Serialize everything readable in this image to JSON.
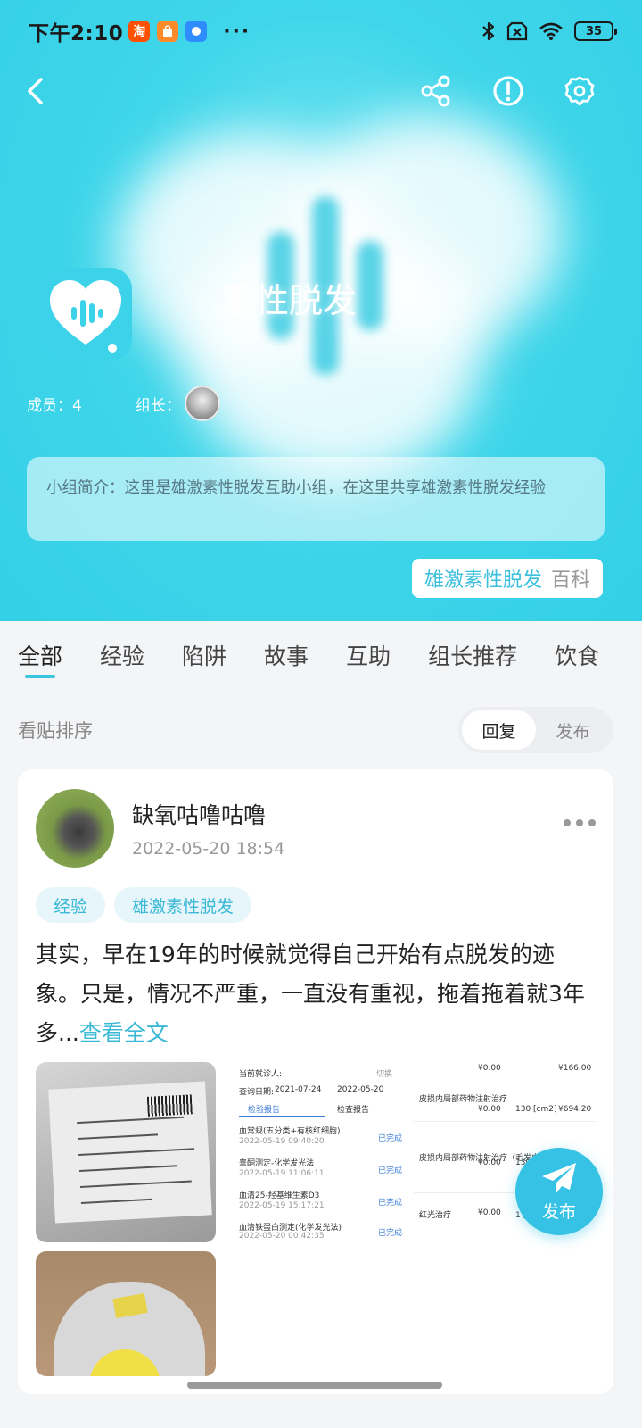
{
  "status_bar": {
    "time": "下午2:10",
    "app_icons": [
      "taobao-icon",
      "shopping-bag-icon",
      "message-bubble-icon"
    ],
    "taobao_text": "淘",
    "dots": "···",
    "battery": "35"
  },
  "header": {
    "group_name": "素性脱发",
    "members": "成员：4",
    "leader_label": "组长：",
    "intro": "小组简介：这里是雄激素性脱发互助小组，在这里共享雄激素性脱发经验",
    "wiki_keyword": "雄激素性脱发",
    "wiki_suffix": "百科",
    "accent_color": "#3cd3ea"
  },
  "tabs": [
    "全部",
    "经验",
    "陷阱",
    "故事",
    "互助",
    "组长推荐",
    "饮食"
  ],
  "active_tab": "全部",
  "sort": {
    "label": "看贴排序",
    "options": [
      "回复",
      "发布"
    ],
    "selected": "回复"
  },
  "post": {
    "author": "缺氧咕噜咕噜",
    "time": "2022-05-20 18:54",
    "tags": [
      "经验",
      "雄激素性脱发"
    ],
    "body": "其实，早在19年的时候就觉得自己开始有点脱发的迹象。只是，情况不严重，一直没有重视，拖着拖着就3年多...",
    "more_link": "查看全文",
    "report_thumb": {
      "patient": "当前就诊人:",
      "switch": "切换",
      "date_label": "查询日期:",
      "date_from": "2021-07-24",
      "date_to": "2022-05-20",
      "tab_exam": "检验报告",
      "tab_check": "检查报告",
      "rows": [
        {
          "name": "血常规(五分类+有核红细胞)",
          "time": "2022-05-19 09:40:20",
          "status": "已完成"
        },
        {
          "name": "睾酮测定-化学发光法",
          "time": "2022-05-19 11:06:11",
          "status": "已完成"
        },
        {
          "name": "血清25-羟基维生素D3",
          "time": "2022-05-19 15:17:21",
          "status": "已完成"
        },
        {
          "name": "血清铁蛋白测定(化学发光法)",
          "time": "2022-05-20 00:42:35",
          "status": "已完成"
        }
      ]
    },
    "bill_thumb": {
      "rows": [
        {
          "item": "皮损内局部药物注射治疗",
          "price": "¥0.00",
          "qty": "130 [cm2]",
          "total": "¥694.20"
        },
        {
          "item": "皮损内局部药物注射治疗（毛发中心）",
          "price": "¥0.00",
          "qty": "130 [cm2]",
          "total": ""
        },
        {
          "item": "红光治疗",
          "price": "¥0.00",
          "qty": "1 [位]",
          "total": ""
        }
      ],
      "top_price": "¥0.00",
      "top_total": "¥166.00"
    }
  },
  "fab": {
    "label": "发布"
  }
}
